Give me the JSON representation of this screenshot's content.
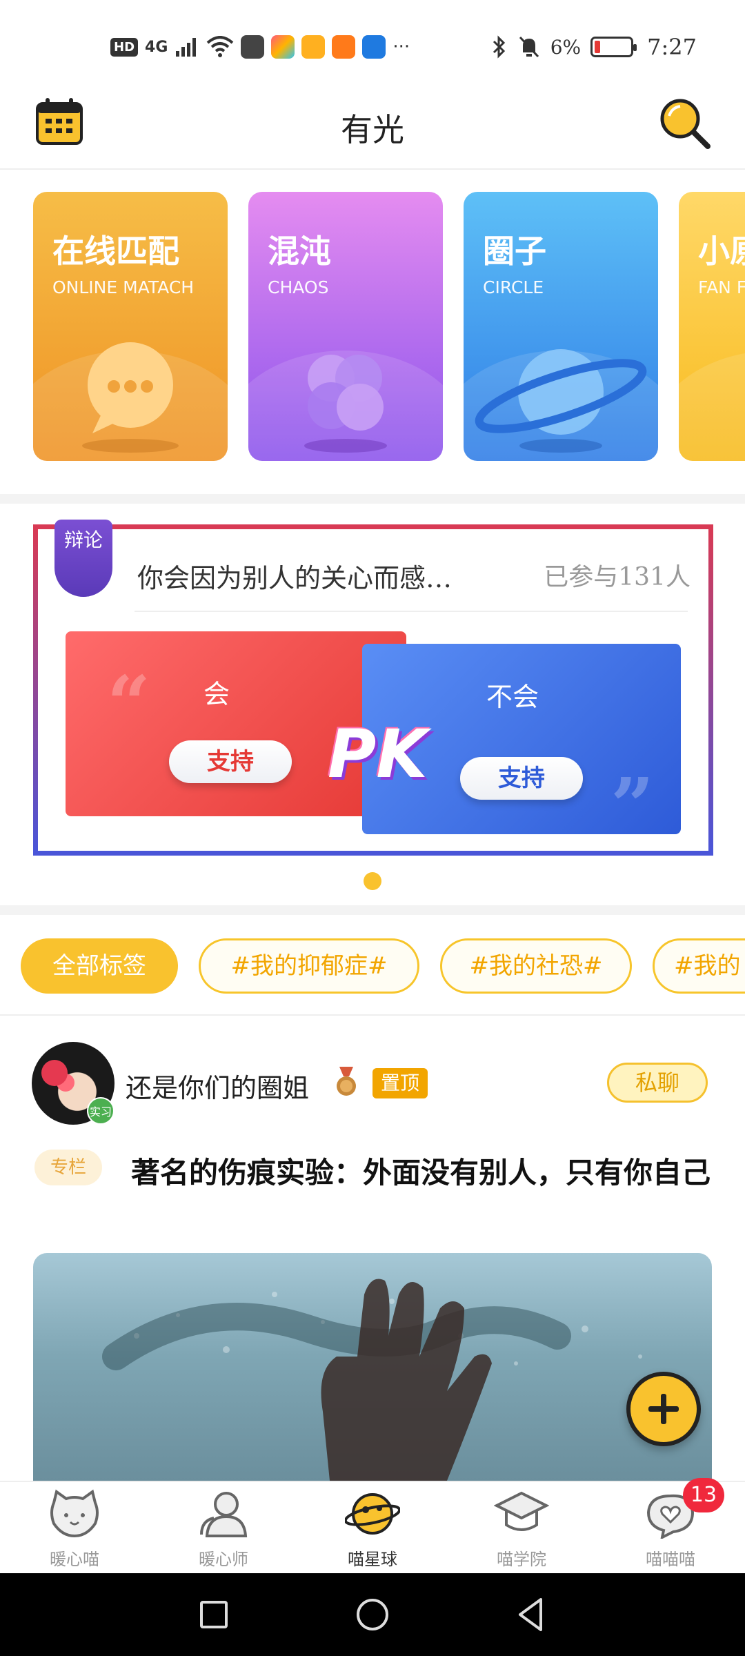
{
  "status_bar": {
    "hd": "HD",
    "network": "4G",
    "battery_percent": "6%",
    "time": "7:27",
    "more": "···"
  },
  "header": {
    "title": "有光"
  },
  "feature_cards": [
    {
      "title": "在线匹配",
      "subtitle": "ONLINE MATACH",
      "color": "#f2a229"
    },
    {
      "title": "混沌",
      "subtitle": "CHAOS",
      "color": "#9a63ec"
    },
    {
      "title": "圈子",
      "subtitle": "CIRCLE",
      "color": "#3d8df0"
    },
    {
      "title": "小原",
      "subtitle": "FAN F",
      "color": "#f9c22e"
    }
  ],
  "debate": {
    "badge": "辩论",
    "question": "你会因为别人的关心而感…",
    "participants": "已参与131人",
    "pro_label": "会",
    "con_label": "不会",
    "support_label": "支持",
    "pk": "PK"
  },
  "tags": [
    {
      "label": "全部标签",
      "active": true
    },
    {
      "label": "#我的抑郁症#",
      "active": false
    },
    {
      "label": "#我的社恐#",
      "active": false
    },
    {
      "label": "#我的",
      "active": false
    }
  ],
  "post": {
    "user_name": "还是你们的圈姐",
    "pin_badge": "置顶",
    "intern_badge": "实习",
    "private_chat": "私聊",
    "column_tag": "专栏",
    "title": "著名的伤痕实验：外面没有别人，只有你自己"
  },
  "tabs": [
    {
      "label": "暖心喵",
      "icon": "cat-face-icon",
      "active": false
    },
    {
      "label": "暖心师",
      "icon": "people-icon",
      "active": false
    },
    {
      "label": "喵星球",
      "icon": "planet-icon",
      "active": true
    },
    {
      "label": "喵学院",
      "icon": "graduation-cap-icon",
      "active": false
    },
    {
      "label": "喵喵喵",
      "icon": "heart-chat-icon",
      "active": false
    }
  ],
  "notification_count": "13",
  "colors": {
    "accent": "#f9c22e",
    "pro": "#e53935",
    "con": "#2e5bd8"
  }
}
